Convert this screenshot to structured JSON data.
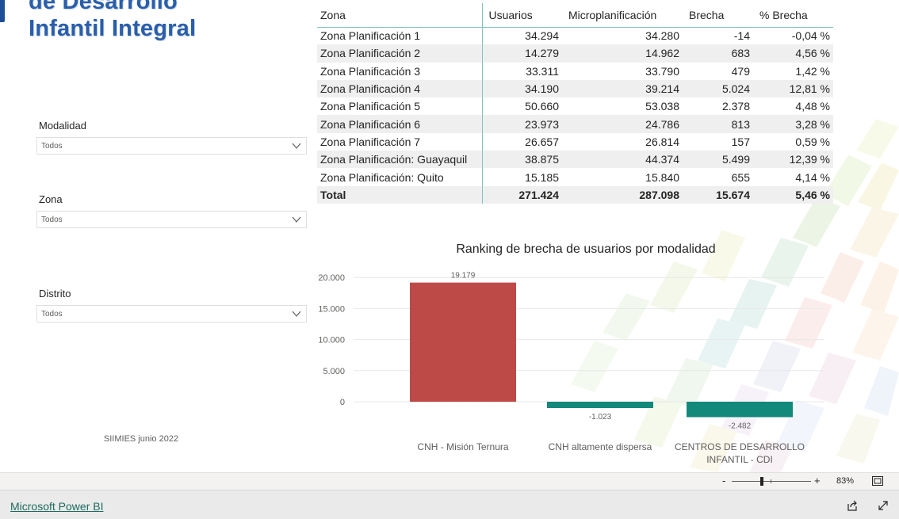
{
  "logo": {
    "line1": "de Desarrollo",
    "line2": "Infantil Integral"
  },
  "slicers": [
    {
      "label": "Modalidad",
      "value": "Todos"
    },
    {
      "label": "Zona",
      "value": "Todos"
    },
    {
      "label": "Distrito",
      "value": "Todos"
    }
  ],
  "footnote": "SIIMIES junio 2022",
  "table": {
    "headers": [
      "Zona",
      "Usuarios",
      "Microplanificación",
      "Brecha",
      "% Brecha"
    ],
    "rows": [
      [
        "Zona Planificación 1",
        "34.294",
        "34.280",
        "-14",
        "-0,04 %"
      ],
      [
        "Zona Planificación 2",
        "14.279",
        "14.962",
        "683",
        "4,56 %"
      ],
      [
        "Zona Planificación 3",
        "33.311",
        "33.790",
        "479",
        "1,42 %"
      ],
      [
        "Zona Planificación 4",
        "34.190",
        "39.214",
        "5.024",
        "12,81 %"
      ],
      [
        "Zona Planificación 5",
        "50.660",
        "53.038",
        "2.378",
        "4,48 %"
      ],
      [
        "Zona Planificación 6",
        "23.973",
        "24.786",
        "813",
        "3,28 %"
      ],
      [
        "Zona Planificación 7",
        "26.657",
        "26.814",
        "157",
        "0,59 %"
      ],
      [
        "Zona Planificación: Guayaquil",
        "38.875",
        "44.374",
        "5.499",
        "12,39 %"
      ],
      [
        "Zona Planificación: Quito",
        "15.185",
        "15.840",
        "655",
        "4,14 %"
      ]
    ],
    "total": [
      "Total",
      "271.424",
      "287.098",
      "15.674",
      "5,46 %"
    ]
  },
  "chart_data": {
    "type": "bar",
    "title": "Ranking de brecha de usuarios por modalidad",
    "categories": [
      "CNH - Misión Ternura",
      "CNH altamente dispersa",
      "CENTROS DE DESARROLLO INFANTIL - CDI"
    ],
    "category_lines": [
      [
        "CNH - Misión Ternura"
      ],
      [
        "CNH altamente dispersa"
      ],
      [
        "CENTROS DE DESARROLLO",
        "INFANTIL - CDI"
      ]
    ],
    "values": [
      19179,
      -1023,
      -2482
    ],
    "data_labels": [
      "19.179",
      "-1.023",
      "-2.482"
    ],
    "colors": [
      "#be4a47",
      "#12897b",
      "#12897b"
    ],
    "yticks": [
      0,
      5000,
      10000,
      15000,
      20000
    ],
    "ytick_labels": [
      "0",
      "5.000",
      "10.000",
      "15.000",
      "20.000"
    ],
    "ylim": [
      -2482,
      20000
    ],
    "grid": true
  },
  "zoom": {
    "minus": "-",
    "plus": "+",
    "level": "83%"
  },
  "footer": {
    "brand": "Microsoft Power BI"
  },
  "icons": [
    "chevron-down-icon",
    "fit-to-page-icon",
    "share-icon",
    "expand-icon"
  ]
}
